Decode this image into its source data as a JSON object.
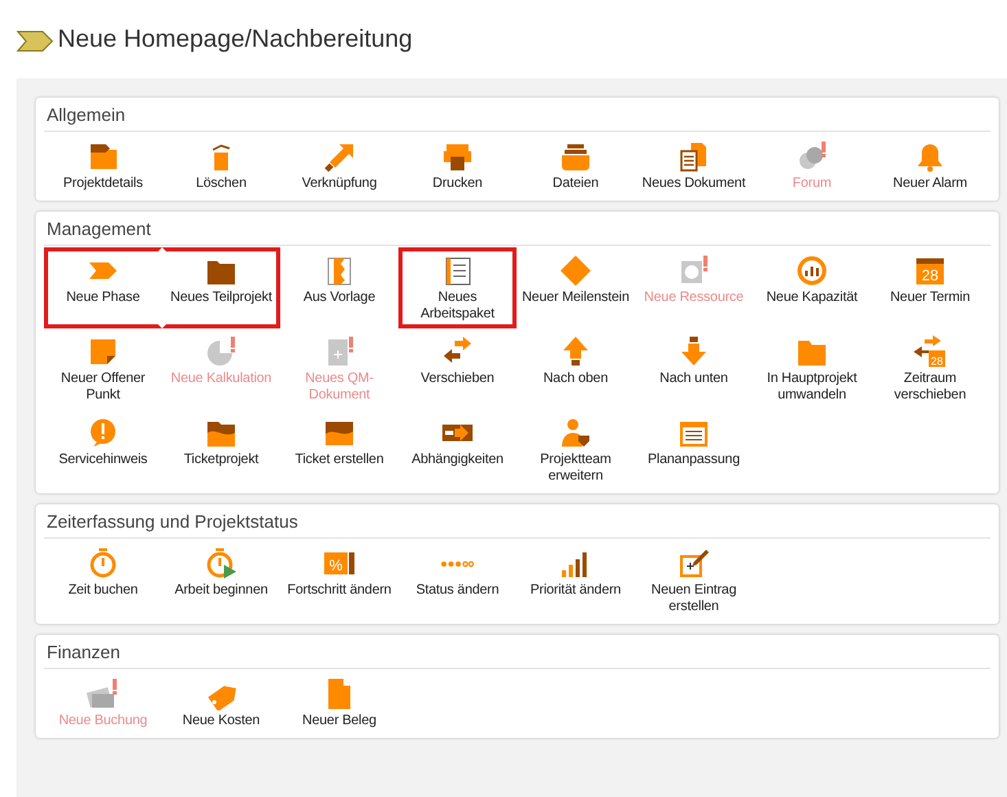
{
  "header": {
    "title": "Neue Homepage/Nachbereitung"
  },
  "sections": [
    {
      "title": "Allgemein",
      "items": [
        {
          "label": "Projektdetails",
          "kind": "folder-tag",
          "disabled": false,
          "highlighted": false
        },
        {
          "label": "Löschen",
          "kind": "trash",
          "disabled": false,
          "highlighted": false
        },
        {
          "label": "Verknüpfung",
          "kind": "arrow",
          "disabled": false,
          "highlighted": false
        },
        {
          "label": "Drucken",
          "kind": "printer",
          "disabled": false,
          "highlighted": false
        },
        {
          "label": "Dateien",
          "kind": "drawer",
          "disabled": false,
          "highlighted": false
        },
        {
          "label": "Neues Dokument",
          "kind": "documents",
          "disabled": false,
          "highlighted": false
        },
        {
          "label": "Forum",
          "kind": "chat",
          "disabled": true,
          "highlighted": false
        },
        {
          "label": "Neuer Alarm",
          "kind": "bell",
          "disabled": false,
          "highlighted": false
        }
      ]
    },
    {
      "title": "Management",
      "items": [
        {
          "label": "Neue Phase",
          "kind": "chevron",
          "disabled": false,
          "highlighted": true
        },
        {
          "label": "Neues Teilprojekt",
          "kind": "folder",
          "disabled": false,
          "highlighted": true
        },
        {
          "label": "Aus Vorlage",
          "kind": "pattern",
          "disabled": false,
          "highlighted": false
        },
        {
          "label": "Neues Arbeitspaket",
          "kind": "notebook",
          "disabled": false,
          "highlighted": true
        },
        {
          "label": "Neuer Meilenstein",
          "kind": "diamond",
          "disabled": false,
          "highlighted": false
        },
        {
          "label": "Neue Ressource",
          "kind": "clock-alert",
          "disabled": true,
          "highlighted": false
        },
        {
          "label": "Neue Kapazität",
          "kind": "gauge",
          "disabled": false,
          "highlighted": false
        },
        {
          "label": "Neuer Termin",
          "kind": "calendar",
          "icon_text": "28",
          "disabled": false,
          "highlighted": false
        },
        {
          "label": "Neuer Offener Punkt",
          "kind": "note",
          "disabled": false,
          "highlighted": false
        },
        {
          "label": "Neue Kalkulation",
          "kind": "pie",
          "disabled": true,
          "highlighted": false
        },
        {
          "label": "Neues QM-Dokument",
          "kind": "doc-alert",
          "disabled": true,
          "highlighted": false
        },
        {
          "label": "Verschieben",
          "kind": "swap",
          "disabled": false,
          "highlighted": false
        },
        {
          "label": "Nach oben",
          "kind": "up",
          "disabled": false,
          "highlighted": false
        },
        {
          "label": "Nach unten",
          "kind": "down",
          "disabled": false,
          "highlighted": false
        },
        {
          "label": "In Hauptprojekt umwandeln",
          "kind": "folder-plain",
          "disabled": false,
          "highlighted": false
        },
        {
          "label": "Zeitraum verschieben",
          "kind": "swap-calendar",
          "icon_text": "28",
          "disabled": false,
          "highlighted": false
        },
        {
          "label": "Servicehinweis",
          "kind": "alert",
          "disabled": false,
          "highlighted": false
        },
        {
          "label": "Ticketprojekt",
          "kind": "folder-wave",
          "disabled": false,
          "highlighted": false
        },
        {
          "label": "Ticket erstellen",
          "kind": "wave",
          "disabled": false,
          "highlighted": false
        },
        {
          "label": "Abhängigkeiten",
          "kind": "split",
          "disabled": false,
          "highlighted": false
        },
        {
          "label": "Projektteam erweitern",
          "kind": "person",
          "disabled": false,
          "highlighted": false
        },
        {
          "label": "Plananpassung",
          "kind": "planner",
          "disabled": false,
          "highlighted": false
        }
      ]
    },
    {
      "title": "Zeiterfassung und Projektstatus",
      "items": [
        {
          "label": "Zeit buchen",
          "kind": "stopwatch",
          "disabled": false,
          "highlighted": false
        },
        {
          "label": "Arbeit beginnen",
          "kind": "stopwatch-play",
          "disabled": false,
          "highlighted": false
        },
        {
          "label": "Fortschritt ändern",
          "kind": "percent",
          "icon_text": "%",
          "disabled": false,
          "highlighted": false
        },
        {
          "label": "Status ändern",
          "kind": "dots",
          "disabled": false,
          "highlighted": false
        },
        {
          "label": "Priorität ändern",
          "kind": "bars",
          "disabled": false,
          "highlighted": false
        },
        {
          "label": "Neuen Eintrag erstellen",
          "kind": "edit",
          "disabled": false,
          "highlighted": false
        }
      ]
    },
    {
      "title": "Finanzen",
      "items": [
        {
          "label": "Neue Buchung",
          "kind": "card",
          "disabled": true,
          "highlighted": false
        },
        {
          "label": "Neue Kosten",
          "kind": "tag",
          "disabled": false,
          "highlighted": false
        },
        {
          "label": "Neuer Beleg",
          "kind": "page",
          "disabled": false,
          "highlighted": false
        }
      ]
    }
  ]
}
